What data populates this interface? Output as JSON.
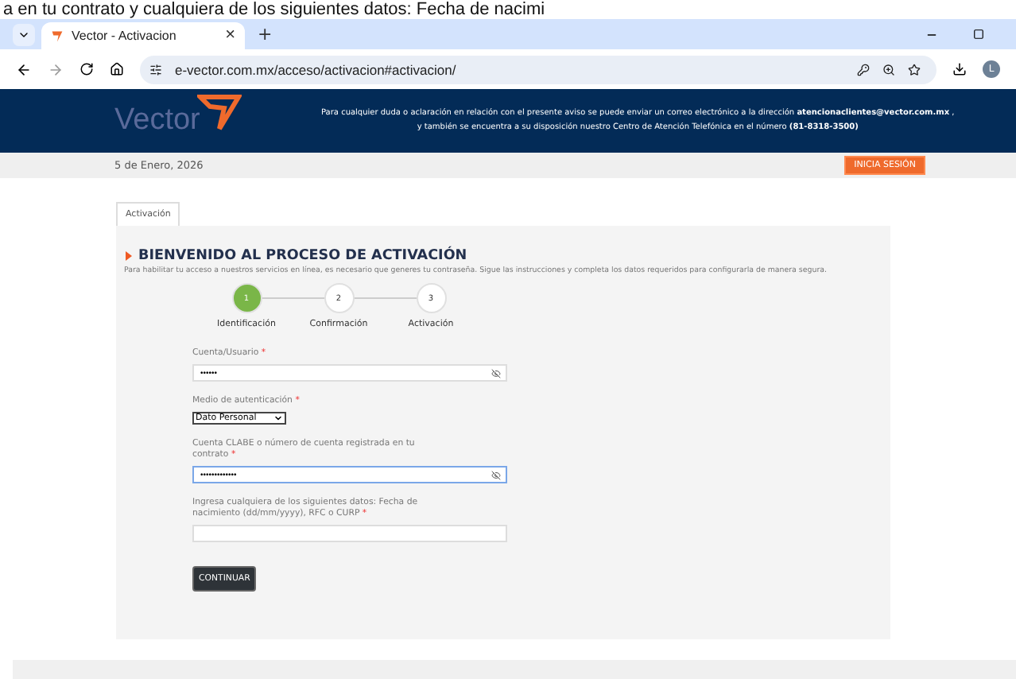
{
  "cut_caption": "a en tu contrato y cualquiera de los siguientes datos: Fecha de nacimi",
  "browser": {
    "tab_title": "Vector - Activacion",
    "tab_close": "×",
    "new_tab": "+",
    "url": "e-vector.com.mx/acceso/activacion#activacion/",
    "profile_initial": "L"
  },
  "banner": {
    "logo": "Vector",
    "notice_line_1": "Para cualquier duda o aclaración en relación con el presente aviso se puede enviar un correo electrónico a la dirección **atencionaclientes@vector.com.mx** ,",
    "notice_line_2": "y también se encuentra a su disposición nuestro Centro de Atención Telefónica en el número **(81-8318-3500)**"
  },
  "date_bar": {
    "date": "5 de Enero, 2026",
    "login_button": "INICIA SESIÓN"
  },
  "tabs": [
    {
      "label": "Activación",
      "selected": true
    }
  ],
  "heading": "BIENVENIDO AL PROCESO DE ACTIVACIÓN",
  "intro": "Para habilitar tu acceso a nuestros servicios en línea, es necesario que generes tu contraseña. Sigue las instrucciones y completa los datos requeridos para configurarla de manera segura.",
  "steps": [
    {
      "number": "1",
      "label": "Identificación",
      "selected": true
    },
    {
      "number": "2",
      "label": "Confirmación",
      "selected": false
    },
    {
      "number": "3",
      "label": "Activación",
      "selected": false
    }
  ],
  "fields": [
    {
      "kind": "secret",
      "label": "Cuenta/Usuario",
      "required_mark": "*",
      "value": "••••••",
      "focused": false
    },
    {
      "kind": "select",
      "label": "Medio de autenticación",
      "required_mark": "*",
      "value": "Dato Personal"
    },
    {
      "kind": "secret",
      "label": "Cuenta CLABE o número de cuenta registrada en tu contrato",
      "required_mark": "*",
      "value": "•••••••••••••",
      "focused": true
    },
    {
      "kind": "text",
      "label": "Ingresa cualquiera de los siguientes datos: Fecha de nacimiento (dd/mm/yyyy), RFC o CURP",
      "required_mark": "*",
      "focused": false
    }
  ],
  "submit": "CONTINUAR"
}
